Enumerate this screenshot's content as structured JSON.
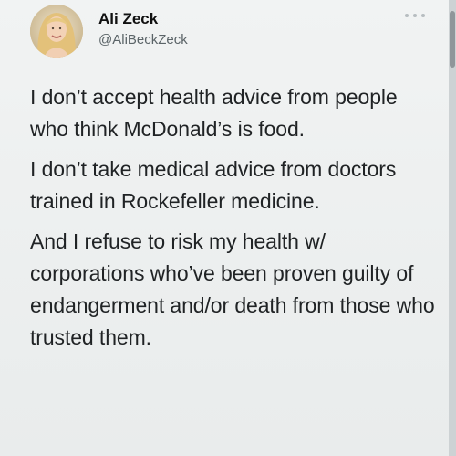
{
  "tweet": {
    "author": {
      "display_name": "Ali Zeck",
      "handle": "@AliBeckZeck"
    },
    "more_icon": "more-horizontal-icon",
    "paragraphs": [
      "I don’t accept health advice from people who think McDonald’s is food.",
      "I don’t take medical advice from doctors trained in Rockefeller medicine.",
      "And I refuse to risk my health w/ corporations who’ve been proven guilty of endangerment and/or death from those who trusted them."
    ]
  }
}
